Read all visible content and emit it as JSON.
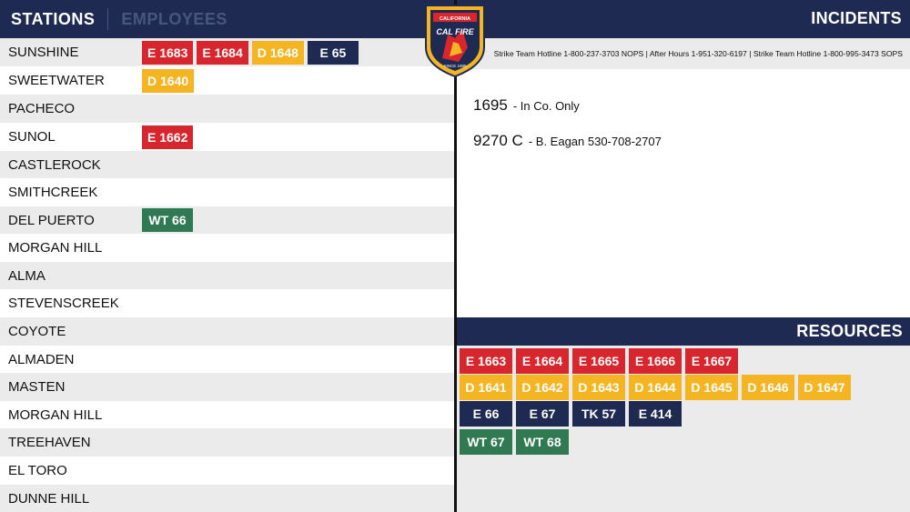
{
  "colors": {
    "navy": "#1e2a52",
    "engine_red": "#d7262d",
    "dozer_yellow": "#f5b523",
    "navy_unit": "#1e2a52",
    "water_green": "#2f7a52"
  },
  "tabs": {
    "stations": "STATIONS",
    "employees": "EMPLOYEES"
  },
  "logo": {
    "icon": "cal-fire-shield-icon",
    "text": "CAL FIRE",
    "since": "SINCE 1885"
  },
  "stations": [
    {
      "name": "SUNSHINE",
      "units": [
        {
          "label": "E 1683",
          "color": "#d7262d"
        },
        {
          "label": "E 1684",
          "color": "#d7262d"
        },
        {
          "label": "D 1648",
          "color": "#f5b523"
        },
        {
          "label": "E 65",
          "color": "#1e2a52"
        }
      ]
    },
    {
      "name": "SWEETWATER",
      "units": [
        {
          "label": "D 1640",
          "color": "#f5b523"
        }
      ]
    },
    {
      "name": "PACHECO",
      "units": []
    },
    {
      "name": "SUNOL",
      "units": [
        {
          "label": "E 1662",
          "color": "#d7262d"
        }
      ]
    },
    {
      "name": "CASTLEROCK",
      "units": []
    },
    {
      "name": "SMITHCREEK",
      "units": []
    },
    {
      "name": "DEL PUERTO",
      "units": [
        {
          "label": "WT 66",
          "color": "#2f7a52"
        }
      ]
    },
    {
      "name": "MORGAN HILL",
      "units": []
    },
    {
      "name": "ALMA",
      "units": []
    },
    {
      "name": "STEVENSCREEK",
      "units": []
    },
    {
      "name": "COYOTE",
      "units": []
    },
    {
      "name": "ALMADEN",
      "units": []
    },
    {
      "name": "MASTEN",
      "units": []
    },
    {
      "name": "MORGAN HILL",
      "units": []
    },
    {
      "name": "TREEHAVEN",
      "units": []
    },
    {
      "name": "EL TORO",
      "units": []
    },
    {
      "name": "DUNNE HILL",
      "units": []
    }
  ],
  "incidents": {
    "title": "INCIDENTS",
    "hotline": "Strike Team Hotline 1-800-237-3703 NOPS | After Hours 1-951-320-6197 | Strike Team Hotline 1-800-995-3473 SOPS",
    "items": [
      {
        "id": "1695",
        "note": "-  In Co. Only"
      },
      {
        "id": "9270 C",
        "note": "- B. Eagan 530-708-2707"
      }
    ]
  },
  "resources": {
    "title": "RESOURCES",
    "rows": [
      [
        {
          "label": "E 1663",
          "color": "#d7262d"
        },
        {
          "label": "E 1664",
          "color": "#d7262d"
        },
        {
          "label": "E 1665",
          "color": "#d7262d"
        },
        {
          "label": "E 1666",
          "color": "#d7262d"
        },
        {
          "label": "E 1667",
          "color": "#d7262d"
        }
      ],
      [
        {
          "label": "D 1641",
          "color": "#f5b523"
        },
        {
          "label": "D 1642",
          "color": "#f5b523"
        },
        {
          "label": "D 1643",
          "color": "#f5b523"
        },
        {
          "label": "D 1644",
          "color": "#f5b523"
        },
        {
          "label": "D 1645",
          "color": "#f5b523"
        },
        {
          "label": "D 1646",
          "color": "#f5b523"
        },
        {
          "label": "D 1647",
          "color": "#f5b523"
        }
      ],
      [
        {
          "label": "E 66",
          "color": "#1e2a52"
        },
        {
          "label": "E 67",
          "color": "#1e2a52"
        },
        {
          "label": "TK 57",
          "color": "#1e2a52"
        },
        {
          "label": "E 414",
          "color": "#1e2a52"
        }
      ],
      [
        {
          "label": "WT 67",
          "color": "#2f7a52"
        },
        {
          "label": "WT 68",
          "color": "#2f7a52"
        }
      ]
    ]
  }
}
